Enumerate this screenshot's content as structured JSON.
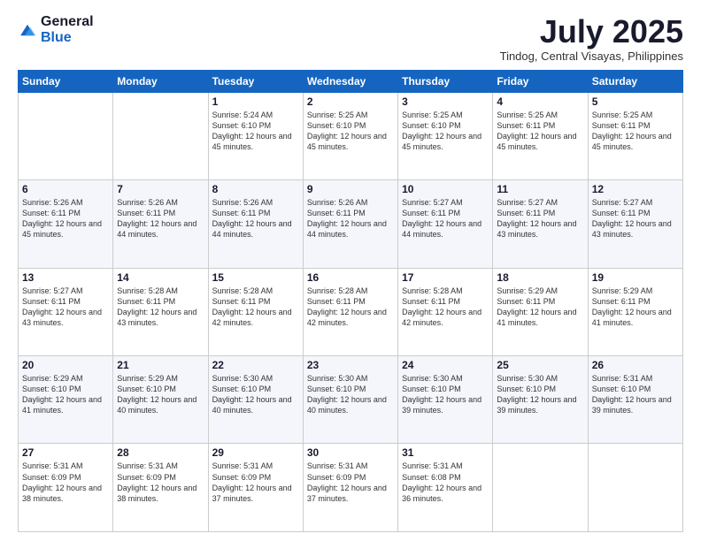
{
  "logo": {
    "general": "General",
    "blue": "Blue"
  },
  "title": "July 2025",
  "location": "Tindog, Central Visayas, Philippines",
  "days_of_week": [
    "Sunday",
    "Monday",
    "Tuesday",
    "Wednesday",
    "Thursday",
    "Friday",
    "Saturday"
  ],
  "weeks": [
    [
      {
        "day": "",
        "sunrise": "",
        "sunset": "",
        "daylight": ""
      },
      {
        "day": "",
        "sunrise": "",
        "sunset": "",
        "daylight": ""
      },
      {
        "day": "1",
        "sunrise": "Sunrise: 5:24 AM",
        "sunset": "Sunset: 6:10 PM",
        "daylight": "Daylight: 12 hours and 45 minutes."
      },
      {
        "day": "2",
        "sunrise": "Sunrise: 5:25 AM",
        "sunset": "Sunset: 6:10 PM",
        "daylight": "Daylight: 12 hours and 45 minutes."
      },
      {
        "day": "3",
        "sunrise": "Sunrise: 5:25 AM",
        "sunset": "Sunset: 6:10 PM",
        "daylight": "Daylight: 12 hours and 45 minutes."
      },
      {
        "day": "4",
        "sunrise": "Sunrise: 5:25 AM",
        "sunset": "Sunset: 6:11 PM",
        "daylight": "Daylight: 12 hours and 45 minutes."
      },
      {
        "day": "5",
        "sunrise": "Sunrise: 5:25 AM",
        "sunset": "Sunset: 6:11 PM",
        "daylight": "Daylight: 12 hours and 45 minutes."
      }
    ],
    [
      {
        "day": "6",
        "sunrise": "Sunrise: 5:26 AM",
        "sunset": "Sunset: 6:11 PM",
        "daylight": "Daylight: 12 hours and 45 minutes."
      },
      {
        "day": "7",
        "sunrise": "Sunrise: 5:26 AM",
        "sunset": "Sunset: 6:11 PM",
        "daylight": "Daylight: 12 hours and 44 minutes."
      },
      {
        "day": "8",
        "sunrise": "Sunrise: 5:26 AM",
        "sunset": "Sunset: 6:11 PM",
        "daylight": "Daylight: 12 hours and 44 minutes."
      },
      {
        "day": "9",
        "sunrise": "Sunrise: 5:26 AM",
        "sunset": "Sunset: 6:11 PM",
        "daylight": "Daylight: 12 hours and 44 minutes."
      },
      {
        "day": "10",
        "sunrise": "Sunrise: 5:27 AM",
        "sunset": "Sunset: 6:11 PM",
        "daylight": "Daylight: 12 hours and 44 minutes."
      },
      {
        "day": "11",
        "sunrise": "Sunrise: 5:27 AM",
        "sunset": "Sunset: 6:11 PM",
        "daylight": "Daylight: 12 hours and 43 minutes."
      },
      {
        "day": "12",
        "sunrise": "Sunrise: 5:27 AM",
        "sunset": "Sunset: 6:11 PM",
        "daylight": "Daylight: 12 hours and 43 minutes."
      }
    ],
    [
      {
        "day": "13",
        "sunrise": "Sunrise: 5:27 AM",
        "sunset": "Sunset: 6:11 PM",
        "daylight": "Daylight: 12 hours and 43 minutes."
      },
      {
        "day": "14",
        "sunrise": "Sunrise: 5:28 AM",
        "sunset": "Sunset: 6:11 PM",
        "daylight": "Daylight: 12 hours and 43 minutes."
      },
      {
        "day": "15",
        "sunrise": "Sunrise: 5:28 AM",
        "sunset": "Sunset: 6:11 PM",
        "daylight": "Daylight: 12 hours and 42 minutes."
      },
      {
        "day": "16",
        "sunrise": "Sunrise: 5:28 AM",
        "sunset": "Sunset: 6:11 PM",
        "daylight": "Daylight: 12 hours and 42 minutes."
      },
      {
        "day": "17",
        "sunrise": "Sunrise: 5:28 AM",
        "sunset": "Sunset: 6:11 PM",
        "daylight": "Daylight: 12 hours and 42 minutes."
      },
      {
        "day": "18",
        "sunrise": "Sunrise: 5:29 AM",
        "sunset": "Sunset: 6:11 PM",
        "daylight": "Daylight: 12 hours and 41 minutes."
      },
      {
        "day": "19",
        "sunrise": "Sunrise: 5:29 AM",
        "sunset": "Sunset: 6:11 PM",
        "daylight": "Daylight: 12 hours and 41 minutes."
      }
    ],
    [
      {
        "day": "20",
        "sunrise": "Sunrise: 5:29 AM",
        "sunset": "Sunset: 6:10 PM",
        "daylight": "Daylight: 12 hours and 41 minutes."
      },
      {
        "day": "21",
        "sunrise": "Sunrise: 5:29 AM",
        "sunset": "Sunset: 6:10 PM",
        "daylight": "Daylight: 12 hours and 40 minutes."
      },
      {
        "day": "22",
        "sunrise": "Sunrise: 5:30 AM",
        "sunset": "Sunset: 6:10 PM",
        "daylight": "Daylight: 12 hours and 40 minutes."
      },
      {
        "day": "23",
        "sunrise": "Sunrise: 5:30 AM",
        "sunset": "Sunset: 6:10 PM",
        "daylight": "Daylight: 12 hours and 40 minutes."
      },
      {
        "day": "24",
        "sunrise": "Sunrise: 5:30 AM",
        "sunset": "Sunset: 6:10 PM",
        "daylight": "Daylight: 12 hours and 39 minutes."
      },
      {
        "day": "25",
        "sunrise": "Sunrise: 5:30 AM",
        "sunset": "Sunset: 6:10 PM",
        "daylight": "Daylight: 12 hours and 39 minutes."
      },
      {
        "day": "26",
        "sunrise": "Sunrise: 5:31 AM",
        "sunset": "Sunset: 6:10 PM",
        "daylight": "Daylight: 12 hours and 39 minutes."
      }
    ],
    [
      {
        "day": "27",
        "sunrise": "Sunrise: 5:31 AM",
        "sunset": "Sunset: 6:09 PM",
        "daylight": "Daylight: 12 hours and 38 minutes."
      },
      {
        "day": "28",
        "sunrise": "Sunrise: 5:31 AM",
        "sunset": "Sunset: 6:09 PM",
        "daylight": "Daylight: 12 hours and 38 minutes."
      },
      {
        "day": "29",
        "sunrise": "Sunrise: 5:31 AM",
        "sunset": "Sunset: 6:09 PM",
        "daylight": "Daylight: 12 hours and 37 minutes."
      },
      {
        "day": "30",
        "sunrise": "Sunrise: 5:31 AM",
        "sunset": "Sunset: 6:09 PM",
        "daylight": "Daylight: 12 hours and 37 minutes."
      },
      {
        "day": "31",
        "sunrise": "Sunrise: 5:31 AM",
        "sunset": "Sunset: 6:08 PM",
        "daylight": "Daylight: 12 hours and 36 minutes."
      },
      {
        "day": "",
        "sunrise": "",
        "sunset": "",
        "daylight": ""
      },
      {
        "day": "",
        "sunrise": "",
        "sunset": "",
        "daylight": ""
      }
    ]
  ]
}
